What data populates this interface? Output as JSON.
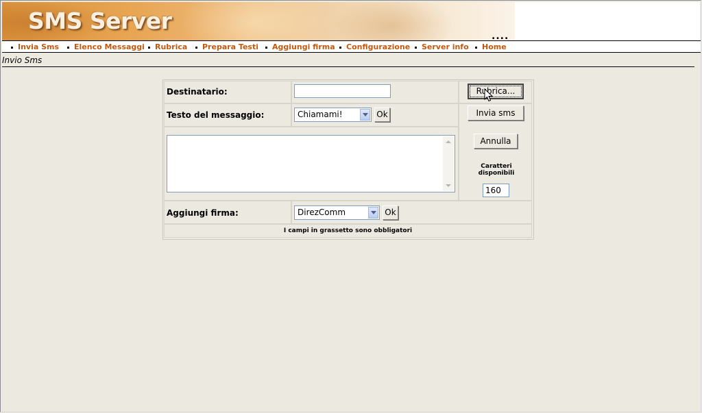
{
  "header": {
    "logo": "SMS Server",
    "dots": "...."
  },
  "nav": [
    {
      "label": "Invia Sms"
    },
    {
      "label": "Elenco Messaggi"
    },
    {
      "label": "Rubrica"
    },
    {
      "label": "Prepara Testi"
    },
    {
      "label": "Aggiungi firma"
    },
    {
      "label": "Configurazione"
    },
    {
      "label": "Server info"
    },
    {
      "label": "Home"
    }
  ],
  "page": {
    "title": "Invio Sms"
  },
  "form": {
    "recipient_label": "Destinatario:",
    "recipient_value": "",
    "rubrica_button": "Rubrica...",
    "message_label": "Testo del messaggio:",
    "message_select": "Chiamami!",
    "ok_label": "Ok",
    "send_button": "Invia sms",
    "cancel_button": "Annulla",
    "chars_label": "Caratteri disponibili",
    "chars_value": "160",
    "signature_label": "Aggiungi firma:",
    "signature_select": "DirezComm",
    "footer_note": "I campi in grassetto sono obbligatori"
  }
}
